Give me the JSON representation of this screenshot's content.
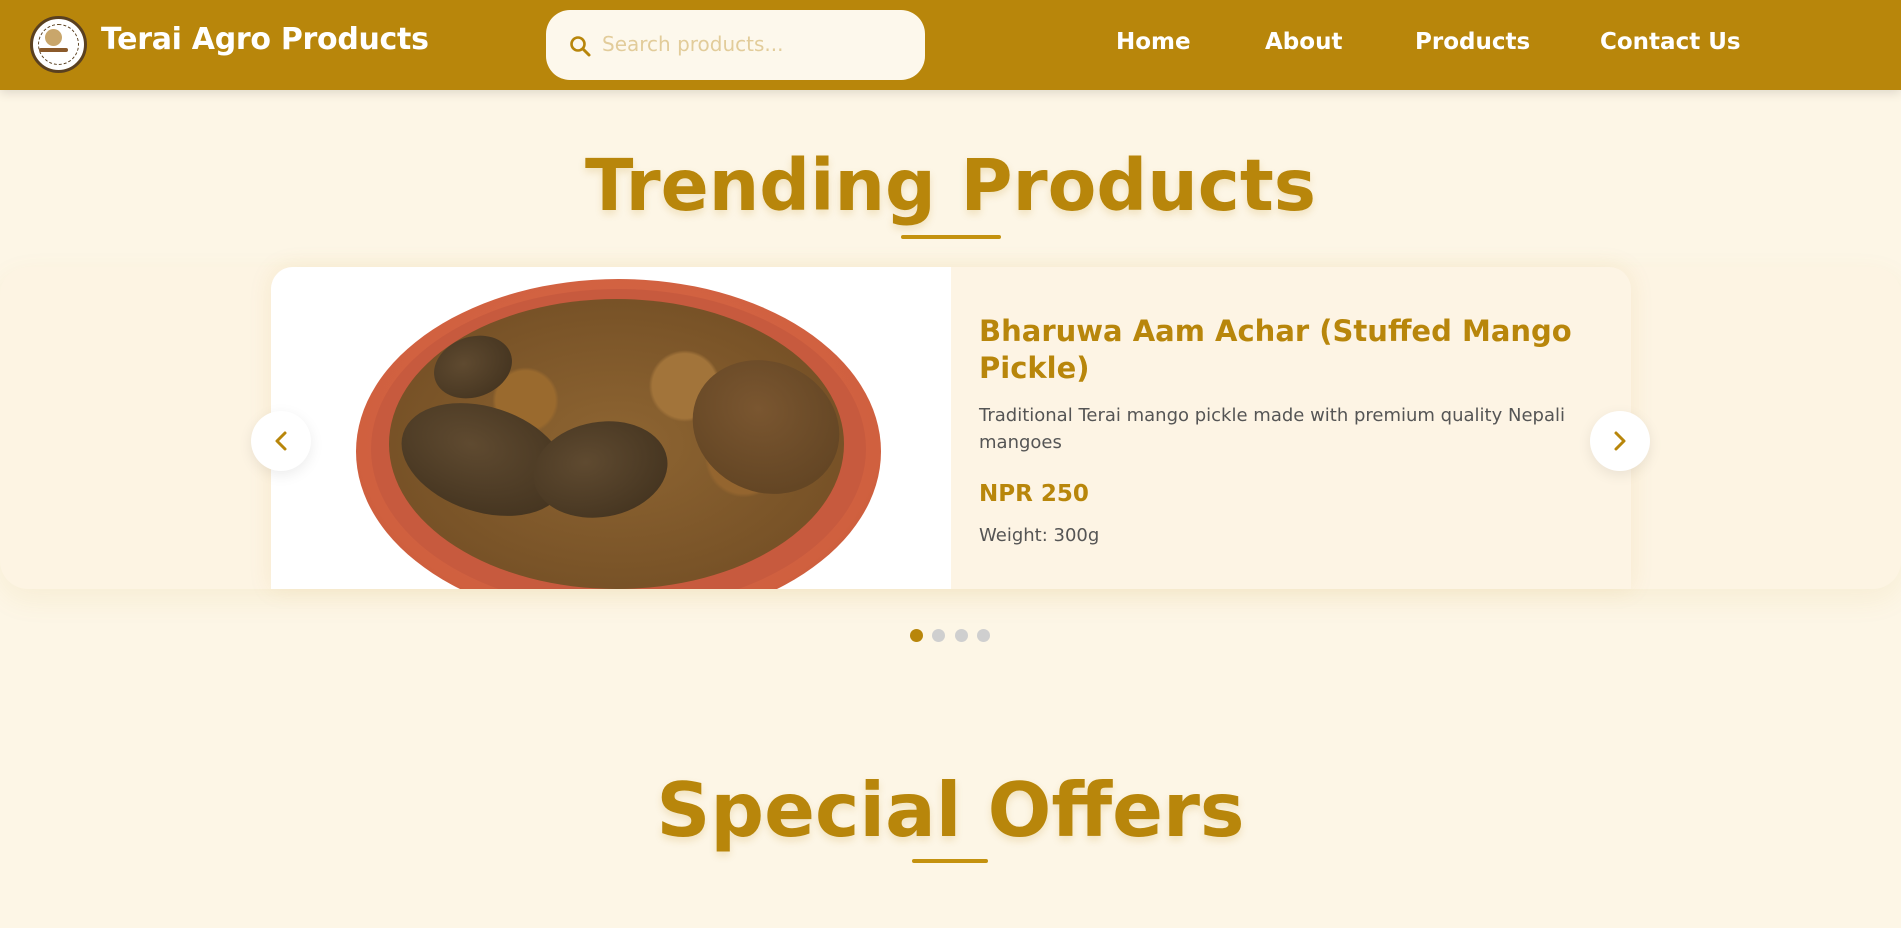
{
  "header": {
    "brand": "Terai Agro Products",
    "search_placeholder": "Search products...",
    "nav": [
      "Home",
      "About",
      "Products",
      "Contact Us"
    ]
  },
  "trending": {
    "title": "Trending Products",
    "product": {
      "name": "Bharuwa Aam Achar (Stuffed Mango Pickle)",
      "description": "Traditional Terai mango pickle made with premium quality Nepali mangoes",
      "price": "NPR 250",
      "weight": "Weight: 300g"
    },
    "slide_count": 4,
    "active_slide": 1
  },
  "offers": {
    "title": "Special Offers"
  },
  "icons": {
    "logo": "terai-agro-logo-icon",
    "search": "search-icon",
    "prev": "chevron-left-icon",
    "next": "chevron-right-icon"
  },
  "colors": {
    "brand": "#b8860b",
    "background": "#fdf6e6",
    "text_muted": "#555555",
    "dot_inactive": "#cfcfcf"
  }
}
